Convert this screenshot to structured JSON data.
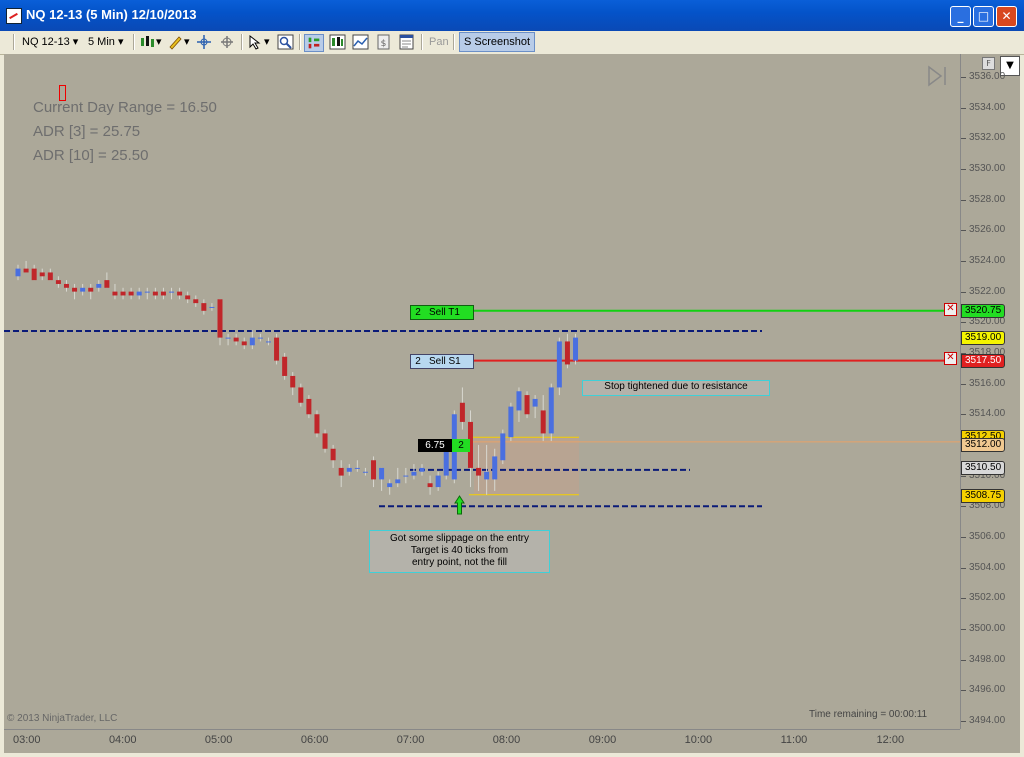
{
  "window": {
    "title": "NQ 12-13 (5 Min)  12/10/2013"
  },
  "toolbar": {
    "instrument": "NQ 12-13",
    "interval": "5 Min",
    "pan_label": "Pan",
    "screenshot_label": "S Screenshot"
  },
  "stats": {
    "range": "Current Day Range = 16.50",
    "adr3": "ADR [3] = 25.75",
    "adr10": "ADR [10] = 25.50"
  },
  "orders": {
    "target_qty": "2",
    "target_name": "Sell T1",
    "target_price": "3520.75",
    "stop_qty": "2",
    "stop_name": "Sell S1",
    "stop_price": "3517.50",
    "position_pnl": "6.75",
    "position_qty": "2"
  },
  "price_labels": {
    "p3519": "3519.00",
    "p3512a": "3512.50",
    "p3512": "3512.00",
    "p3510": "3510.50",
    "p3508": "3508.75"
  },
  "notes": {
    "stop": "Stop tightened due to resistance",
    "entry1": "Got some slippage on the entry",
    "entry2": "Target is 40 ticks from",
    "entry3": "entry point, not the fill"
  },
  "footer": {
    "copyright": "© 2013 NinjaTrader, LLC",
    "time_remaining": "Time remaining = 00:00:11"
  },
  "colors": {
    "bull": "#4a6fe0",
    "bear": "#c0262a",
    "target": "#12d012",
    "stop": "#e02020",
    "level": "#0a1a78",
    "fill": "#e8a268"
  },
  "chart_data": {
    "type": "candlestick",
    "instrument": "NQ 12-13",
    "interval": "5 Min",
    "date": "12/10/2013",
    "y_ticks": [
      "3536.00",
      "3534.00",
      "3532.00",
      "3530.00",
      "3528.00",
      "3526.00",
      "3524.00",
      "3522.00",
      "3520.00",
      "3518.00",
      "3516.00",
      "3514.00",
      "3512.00",
      "3510.00",
      "3508.00",
      "3506.00",
      "3504.00",
      "3502.00",
      "3500.00",
      "3498.00",
      "3496.00",
      "3494.00"
    ],
    "x_ticks": [
      "03:00",
      "04:00",
      "05:00",
      "06:00",
      "07:00",
      "08:00",
      "09:00",
      "10:00",
      "11:00",
      "12:00"
    ],
    "ylim": [
      3493.5,
      3537.0
    ],
    "candles_ohlc": [
      [
        3523.0,
        3523.75,
        3522.75,
        3523.5
      ],
      [
        3523.5,
        3524.0,
        3523.25,
        3523.25
      ],
      [
        3523.5,
        3523.75,
        3522.75,
        3522.75
      ],
      [
        3523.25,
        3523.5,
        3522.75,
        3523.0
      ],
      [
        3523.25,
        3523.5,
        3522.75,
        3522.75
      ],
      [
        3522.75,
        3523.0,
        3522.25,
        3522.5
      ],
      [
        3522.5,
        3522.75,
        3522.0,
        3522.25
      ],
      [
        3522.25,
        3522.5,
        3521.5,
        3522.0
      ],
      [
        3522.0,
        3522.5,
        3521.75,
        3522.25
      ],
      [
        3522.25,
        3522.5,
        3521.5,
        3522.0
      ],
      [
        3522.25,
        3522.75,
        3522.0,
        3522.5
      ],
      [
        3522.75,
        3523.25,
        3522.25,
        3522.25
      ],
      [
        3522.0,
        3522.5,
        3521.5,
        3521.75
      ],
      [
        3522.0,
        3522.25,
        3521.5,
        3521.75
      ],
      [
        3522.0,
        3522.25,
        3521.5,
        3521.75
      ],
      [
        3521.75,
        3522.25,
        3521.5,
        3522.0
      ],
      [
        3522.0,
        3522.25,
        3521.5,
        3522.0
      ],
      [
        3522.0,
        3522.25,
        3521.5,
        3521.75
      ],
      [
        3522.0,
        3522.25,
        3521.5,
        3521.75
      ],
      [
        3522.0,
        3522.25,
        3521.5,
        3522.0
      ],
      [
        3522.0,
        3522.25,
        3521.5,
        3521.75
      ],
      [
        3521.75,
        3522.0,
        3521.25,
        3521.5
      ],
      [
        3521.5,
        3521.75,
        3521.0,
        3521.25
      ],
      [
        3521.25,
        3521.5,
        3520.5,
        3520.75
      ],
      [
        3521.0,
        3521.25,
        3520.75,
        3521.0
      ],
      [
        3521.5,
        3521.5,
        3518.5,
        3519.0
      ],
      [
        3519.0,
        3519.25,
        3518.5,
        3519.0
      ],
      [
        3519.0,
        3519.25,
        3518.5,
        3518.75
      ],
      [
        3518.75,
        3519.0,
        3518.25,
        3518.5
      ],
      [
        3518.5,
        3519.5,
        3518.25,
        3519.0
      ],
      [
        3519.0,
        3519.25,
        3518.75,
        3519.0
      ],
      [
        3518.75,
        3519.0,
        3518.5,
        3518.75
      ],
      [
        3519.0,
        3519.25,
        3517.25,
        3517.5
      ],
      [
        3517.75,
        3518.0,
        3516.25,
        3516.5
      ],
      [
        3516.5,
        3516.75,
        3515.25,
        3515.75
      ],
      [
        3515.75,
        3516.0,
        3514.5,
        3514.75
      ],
      [
        3515.0,
        3515.25,
        3513.75,
        3514.0
      ],
      [
        3514.0,
        3514.25,
        3512.5,
        3512.75
      ],
      [
        3512.75,
        3513.0,
        3511.5,
        3511.75
      ],
      [
        3511.75,
        3512.0,
        3510.5,
        3511.0
      ],
      [
        3510.5,
        3511.0,
        3509.25,
        3510.0
      ],
      [
        3510.25,
        3510.75,
        3510.0,
        3510.5
      ],
      [
        3510.5,
        3511.0,
        3510.25,
        3510.5
      ],
      [
        3510.25,
        3510.5,
        3510.0,
        3510.25
      ],
      [
        3511.0,
        3511.25,
        3509.25,
        3509.75
      ],
      [
        3509.75,
        3510.5,
        3509.0,
        3510.5
      ],
      [
        3509.25,
        3509.75,
        3508.75,
        3509.5
      ],
      [
        3509.5,
        3510.5,
        3509.25,
        3509.75
      ],
      [
        3510.0,
        3510.5,
        3509.5,
        3510.0
      ],
      [
        3510.0,
        3510.75,
        3509.75,
        3510.25
      ],
      [
        3510.25,
        3510.75,
        3510.0,
        3510.5
      ],
      [
        3509.5,
        3510.0,
        3508.75,
        3509.25
      ],
      [
        3509.25,
        3510.25,
        3509.0,
        3510.0
      ],
      [
        3510.0,
        3512.25,
        3509.75,
        3512.0
      ],
      [
        3509.75,
        3514.25,
        3509.5,
        3514.0
      ],
      [
        3514.75,
        3515.75,
        3513.0,
        3513.5
      ],
      [
        3513.5,
        3514.25,
        3509.25,
        3510.5
      ],
      [
        3510.5,
        3512.0,
        3509.0,
        3510.0
      ],
      [
        3509.75,
        3512.0,
        3508.75,
        3510.25
      ],
      [
        3509.75,
        3511.75,
        3509.0,
        3511.25
      ],
      [
        3511.0,
        3513.0,
        3510.75,
        3512.75
      ],
      [
        3512.5,
        3514.75,
        3512.25,
        3514.5
      ],
      [
        3514.25,
        3515.75,
        3513.5,
        3515.5
      ],
      [
        3515.25,
        3515.5,
        3513.75,
        3514.0
      ],
      [
        3514.5,
        3515.25,
        3513.75,
        3515.0
      ],
      [
        3514.25,
        3515.25,
        3512.25,
        3512.75
      ],
      [
        3512.75,
        3516.0,
        3512.25,
        3515.75
      ],
      [
        3515.75,
        3519.0,
        3515.25,
        3518.75
      ],
      [
        3518.75,
        3519.25,
        3517.0,
        3517.25
      ],
      [
        3517.5,
        3519.25,
        3517.25,
        3519.0
      ]
    ],
    "levels": {
      "target": 3520.75,
      "stop": 3517.5,
      "entry": 3512.0,
      "dashed": [
        3519.5,
        3510.5,
        3508.0
      ]
    }
  }
}
